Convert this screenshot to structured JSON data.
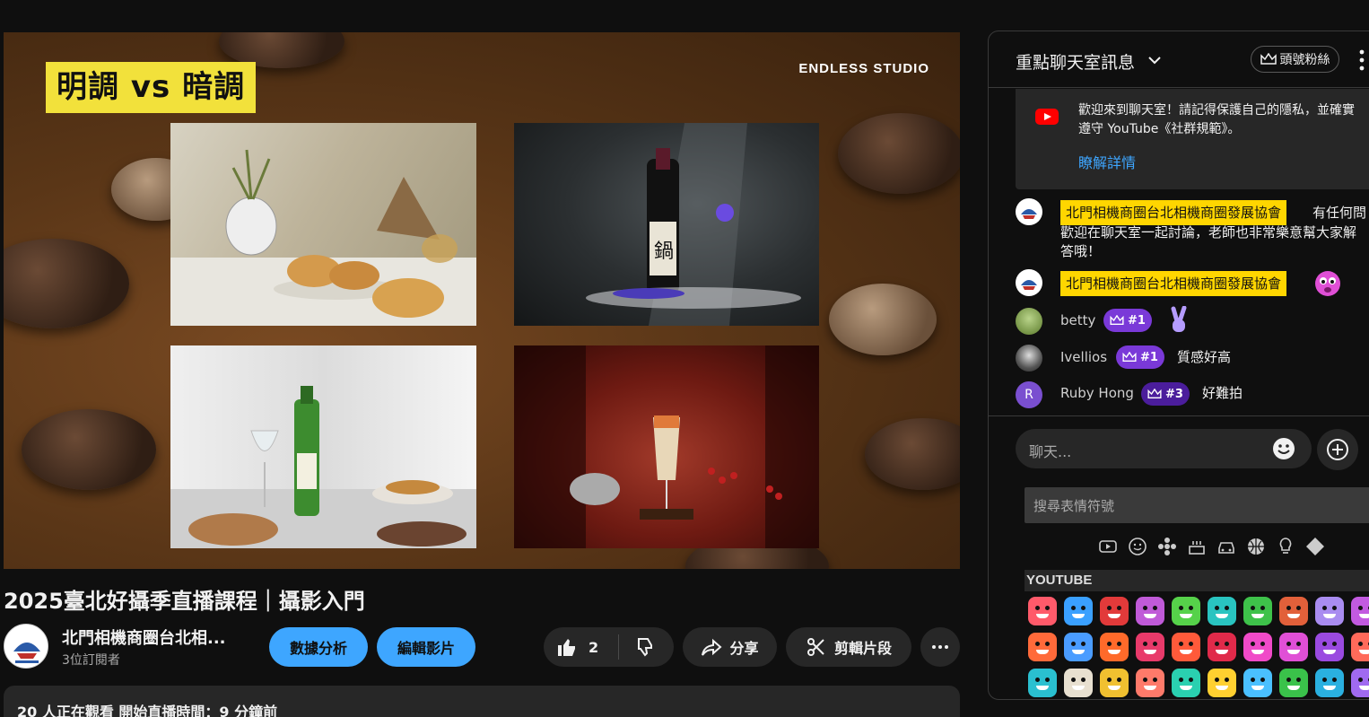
{
  "video": {
    "overlay_title": "明調 vs 暗調",
    "studio": "ENDLESS STUDIO"
  },
  "title": "2025臺北好攝季直播課程｜攝影入門",
  "channel": {
    "name": "北門相機商圈台北相...",
    "subscribers": "3位訂閱者"
  },
  "actions": {
    "analytics": "數據分析",
    "edit": "編輯影片",
    "likes": "2",
    "share": "分享",
    "clip": "剪輯片段"
  },
  "description": {
    "live_status": "20 人正在觀看  開始直播時間：9 分鐘前"
  },
  "chat": {
    "header_title": "重點聊天室訊息",
    "fan_button": "頭號粉絲",
    "welcome_line1": "歡迎來到聊天室！請記得保護自己的隱私，並確實",
    "welcome_line2": "遵守 YouTube《社群規範》。",
    "welcome_link": "瞭解詳情",
    "messages": [
      {
        "author": "北門相機商圈台北相機商圈發展協會",
        "text_line1": "有任何問",
        "text_line2": "歡迎在聊天室一起討論，老師也非常樂意幫大家解",
        "text_line3": "答哦！"
      },
      {
        "author": "北門相機商圈台北相機商圈發展協會"
      },
      {
        "author": "betty",
        "badge": "#1"
      },
      {
        "author": "Ivellios",
        "badge": "#1",
        "text": "質感好高"
      },
      {
        "author": "Ruby Hong",
        "avatar_letter": "R",
        "badge": "#3",
        "text": "好難拍"
      }
    ],
    "input_placeholder": "聊天...",
    "emoji_search_placeholder": "搜尋表情符號",
    "emoji_section": "YOUTUBE"
  },
  "colors": {
    "accent_blue": "#3ea6ff",
    "moderator_yellow": "#ffd600",
    "member_purple": "#7a39d8"
  }
}
